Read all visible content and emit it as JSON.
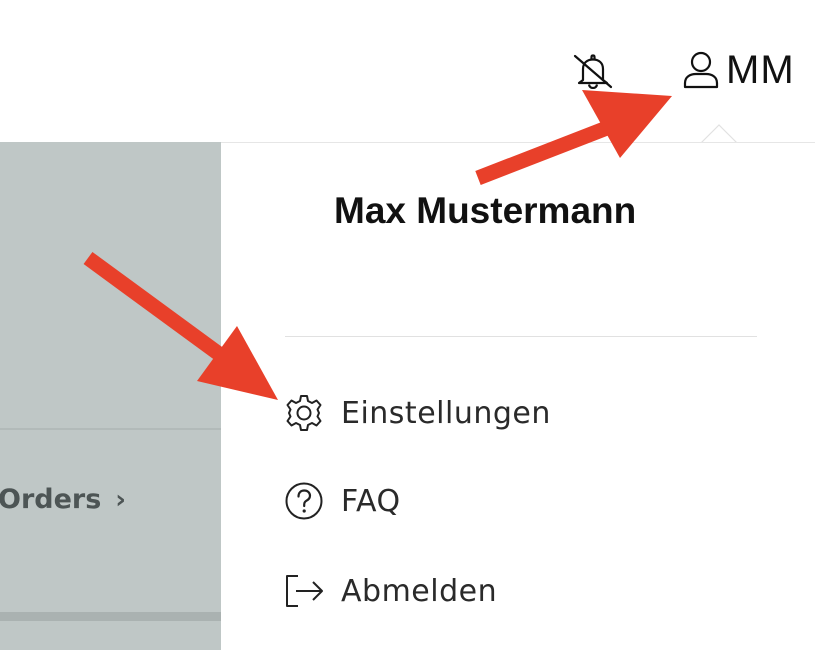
{
  "header": {
    "notifications_icon": "bell-off-icon",
    "user_icon": "user-icon",
    "user_initials": "MM"
  },
  "background": {
    "orders_label": "Orders",
    "orders_chevron": "›"
  },
  "user_menu": {
    "name": "Max Mustermann",
    "items": [
      {
        "icon": "gear-icon",
        "label": "Einstellungen"
      },
      {
        "icon": "question-circle-icon",
        "label": "FAQ"
      },
      {
        "icon": "logout-icon",
        "label": "Abmelden"
      }
    ]
  },
  "annotations": {
    "arrow_color": "#e8402a"
  },
  "colors": {
    "panel_background": "#bfc7c6",
    "text_dark": "#111111"
  }
}
